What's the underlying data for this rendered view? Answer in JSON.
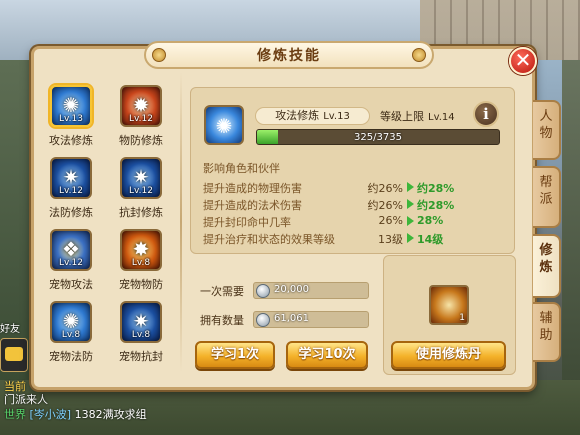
{
  "window": {
    "title": "修炼技能",
    "close_icon": "close-icon"
  },
  "skills": [
    {
      "name": "攻法修炼",
      "level": "Lv.13",
      "icon": "attack-magic-icon",
      "style": "blue",
      "selected": true
    },
    {
      "name": "物防修炼",
      "level": "Lv.12",
      "icon": "physical-defense-icon",
      "style": "red",
      "selected": false
    },
    {
      "name": "法防修炼",
      "level": "Lv.12",
      "icon": "magic-defense-icon",
      "style": "navy",
      "selected": false
    },
    {
      "name": "抗封修炼",
      "level": "Lv.12",
      "icon": "seal-resist-icon",
      "style": "navy",
      "selected": false
    },
    {
      "name": "宠物攻法",
      "level": "Lv.12",
      "icon": "pet-attack-icon",
      "style": "gold",
      "selected": false
    },
    {
      "name": "宠物物防",
      "level": "Lv.8",
      "icon": "pet-physical-defense-icon",
      "style": "fire",
      "selected": false
    },
    {
      "name": "宠物法防",
      "level": "Lv.8",
      "icon": "pet-magic-defense-icon",
      "style": "blue",
      "selected": false
    },
    {
      "name": "宠物抗封",
      "level": "Lv.8",
      "icon": "pet-seal-resist-icon",
      "style": "navy",
      "selected": false
    }
  ],
  "detail": {
    "skill_name": "攻法修炼",
    "skill_level": "Lv.13",
    "limit_label": "等级上限",
    "limit_level": "Lv.14",
    "info_button": "i",
    "progress_text": "325/3735",
    "progress_ratio": 0.087,
    "affect_title": "影响角色和伙伴",
    "attributes": [
      {
        "label": "提升造成的物理伤害",
        "old": "约26%",
        "new": "约28%"
      },
      {
        "label": "提升造成的法术伤害",
        "old": "约26%",
        "new": "约28%"
      },
      {
        "label": "提升封印命中几率",
        "old": "26%",
        "new": "28%"
      },
      {
        "label": "提升治疗和状态的效果等级",
        "old": "13级",
        "new": "14级"
      }
    ]
  },
  "cost": {
    "need_label": "一次需要",
    "need_value": "20,000",
    "own_label": "拥有数量",
    "own_value": "61,061"
  },
  "buttons": {
    "learn_once": "学习1次",
    "learn_ten": "学习10次",
    "use_pill": "使用修炼丹"
  },
  "item": {
    "count": "1",
    "icon": "cultivation-pill-icon"
  },
  "tabs": [
    {
      "label": "人物",
      "active": false
    },
    {
      "label": "帮派",
      "active": false
    },
    {
      "label": "修炼",
      "active": true
    },
    {
      "label": "辅助",
      "active": false
    }
  ],
  "chat": {
    "line1": "当前",
    "line2": "门派来人",
    "line3_channel": "世界",
    "line3_name": "[岑小波]",
    "line3_text": "1382满攻求组"
  },
  "hud": {
    "friend_label": "好友"
  }
}
